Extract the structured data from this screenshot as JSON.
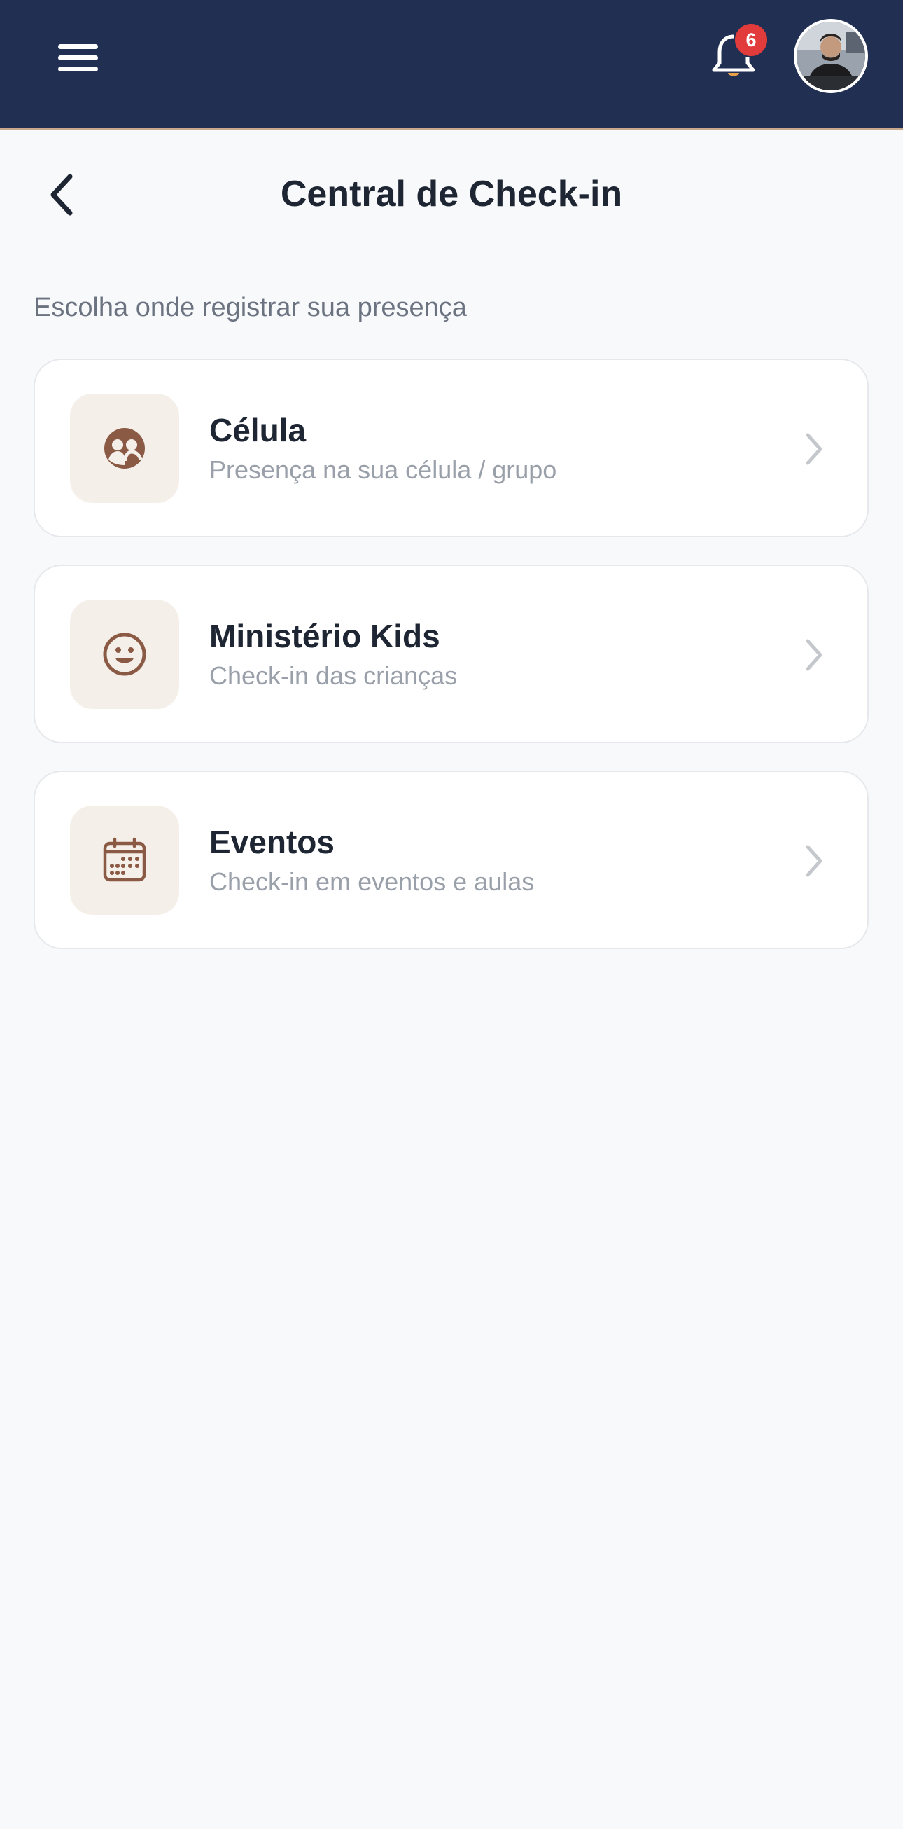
{
  "header": {
    "notification_count": "6",
    "menu_icon": "hamburger-menu-icon",
    "bell_icon": "bell-icon",
    "avatar_icon": "user-avatar",
    "background_color": "#212f52",
    "badge_color": "#e23b3b"
  },
  "page": {
    "title": "Central de Check-in",
    "back_icon": "chevron-left-icon",
    "subtitle": "Escolha onde registrar sua presença"
  },
  "options": [
    {
      "title": "Célula",
      "description": "Presença na sua célula / grupo",
      "icon": "group-icon"
    },
    {
      "title": "Ministério Kids",
      "description": "Check-in das crianças",
      "icon": "smiley-icon"
    },
    {
      "title": "Eventos",
      "description": "Check-in em eventos e aulas",
      "icon": "calendar-icon"
    }
  ],
  "colors": {
    "icon_accent": "#8a5a44",
    "icon_tile_bg": "#f5efea",
    "chevron": "#c4c7cc"
  }
}
